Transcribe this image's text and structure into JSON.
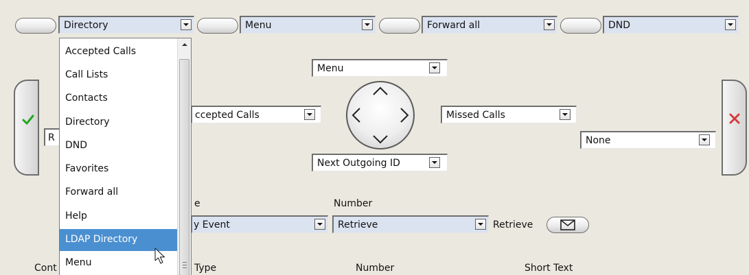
{
  "top_bar": {
    "selects": [
      {
        "value": "Directory"
      },
      {
        "value": "Menu"
      },
      {
        "value": "Forward all"
      },
      {
        "value": "DND"
      }
    ]
  },
  "dropdown": {
    "items": [
      {
        "label": "Accepted Calls"
      },
      {
        "label": "Call Lists"
      },
      {
        "label": "Contacts"
      },
      {
        "label": "Directory"
      },
      {
        "label": "DND"
      },
      {
        "label": "Favorites"
      },
      {
        "label": "Forward all"
      },
      {
        "label": "Help"
      },
      {
        "label": "LDAP Directory",
        "highlighted": true
      },
      {
        "label": "Menu"
      }
    ]
  },
  "nav": {
    "up_select": "Menu",
    "left_select": "ccepted Calls",
    "right_select": "Missed Calls",
    "down_select": "Next Outgoing ID",
    "extra_select": "None",
    "partial_field_text": "R"
  },
  "event_row": {
    "partial_header": "e",
    "number_header": "Number",
    "event_select": "y Event",
    "number_select": "Retrieve",
    "retrieve_label": "Retrieve"
  },
  "table_headers": {
    "partial_first": "Cont",
    "type": "Type",
    "number": "Number",
    "short_text": "Short Text"
  },
  "colors": {
    "accept": "#22a722",
    "reject": "#d63a3a",
    "highlight": "#4a8fd0",
    "select_bg": "#dbe3f1",
    "background": "#ebe9df"
  },
  "icons": {
    "accept": "check-icon",
    "reject": "x-icon",
    "envelope": "envelope-icon",
    "cursor": "mouse-pointer-icon"
  }
}
